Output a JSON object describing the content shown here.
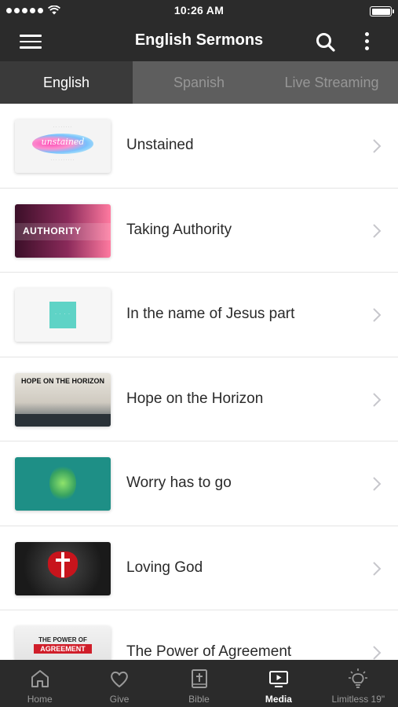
{
  "status_bar": {
    "time": "10:26 AM"
  },
  "header": {
    "title": "English Sermons",
    "menu_icon": "hamburger-icon",
    "search_icon": "search-icon",
    "more_icon": "more-vertical-icon"
  },
  "tabs": [
    {
      "label": "English",
      "active": true
    },
    {
      "label": "Spanish",
      "active": false
    },
    {
      "label": "Live Streaming",
      "active": false
    }
  ],
  "sermons": [
    {
      "title": "Unstained",
      "thumb_text": "unstained"
    },
    {
      "title": "Taking Authority",
      "thumb_text": "AUTHORITY"
    },
    {
      "title": "In the name of Jesus part",
      "thumb_text": ""
    },
    {
      "title": "Hope on the Horizon",
      "thumb_text": "HOPE ON THE HORIZON"
    },
    {
      "title": "Worry has to go",
      "thumb_text": ""
    },
    {
      "title": "Loving God",
      "thumb_text": ""
    },
    {
      "title": "The Power of Agreement",
      "thumb_text_1": "THE POWER OF",
      "thumb_text_2": "AGREEMENT"
    }
  ],
  "bottom_nav": [
    {
      "label": "Home",
      "icon": "home-icon",
      "active": false
    },
    {
      "label": "Give",
      "icon": "heart-icon",
      "active": false
    },
    {
      "label": "Bible",
      "icon": "bible-icon",
      "active": false
    },
    {
      "label": "Media",
      "icon": "media-icon",
      "active": true
    },
    {
      "label": "Limitless 19\"",
      "icon": "lightbulb-icon",
      "active": false
    }
  ],
  "colors": {
    "header_bg": "#2b2b2b",
    "tab_active_bg": "#3a3a3a",
    "tab_inactive_bg": "#5e5e5e",
    "accent_text": "#ffffff"
  }
}
